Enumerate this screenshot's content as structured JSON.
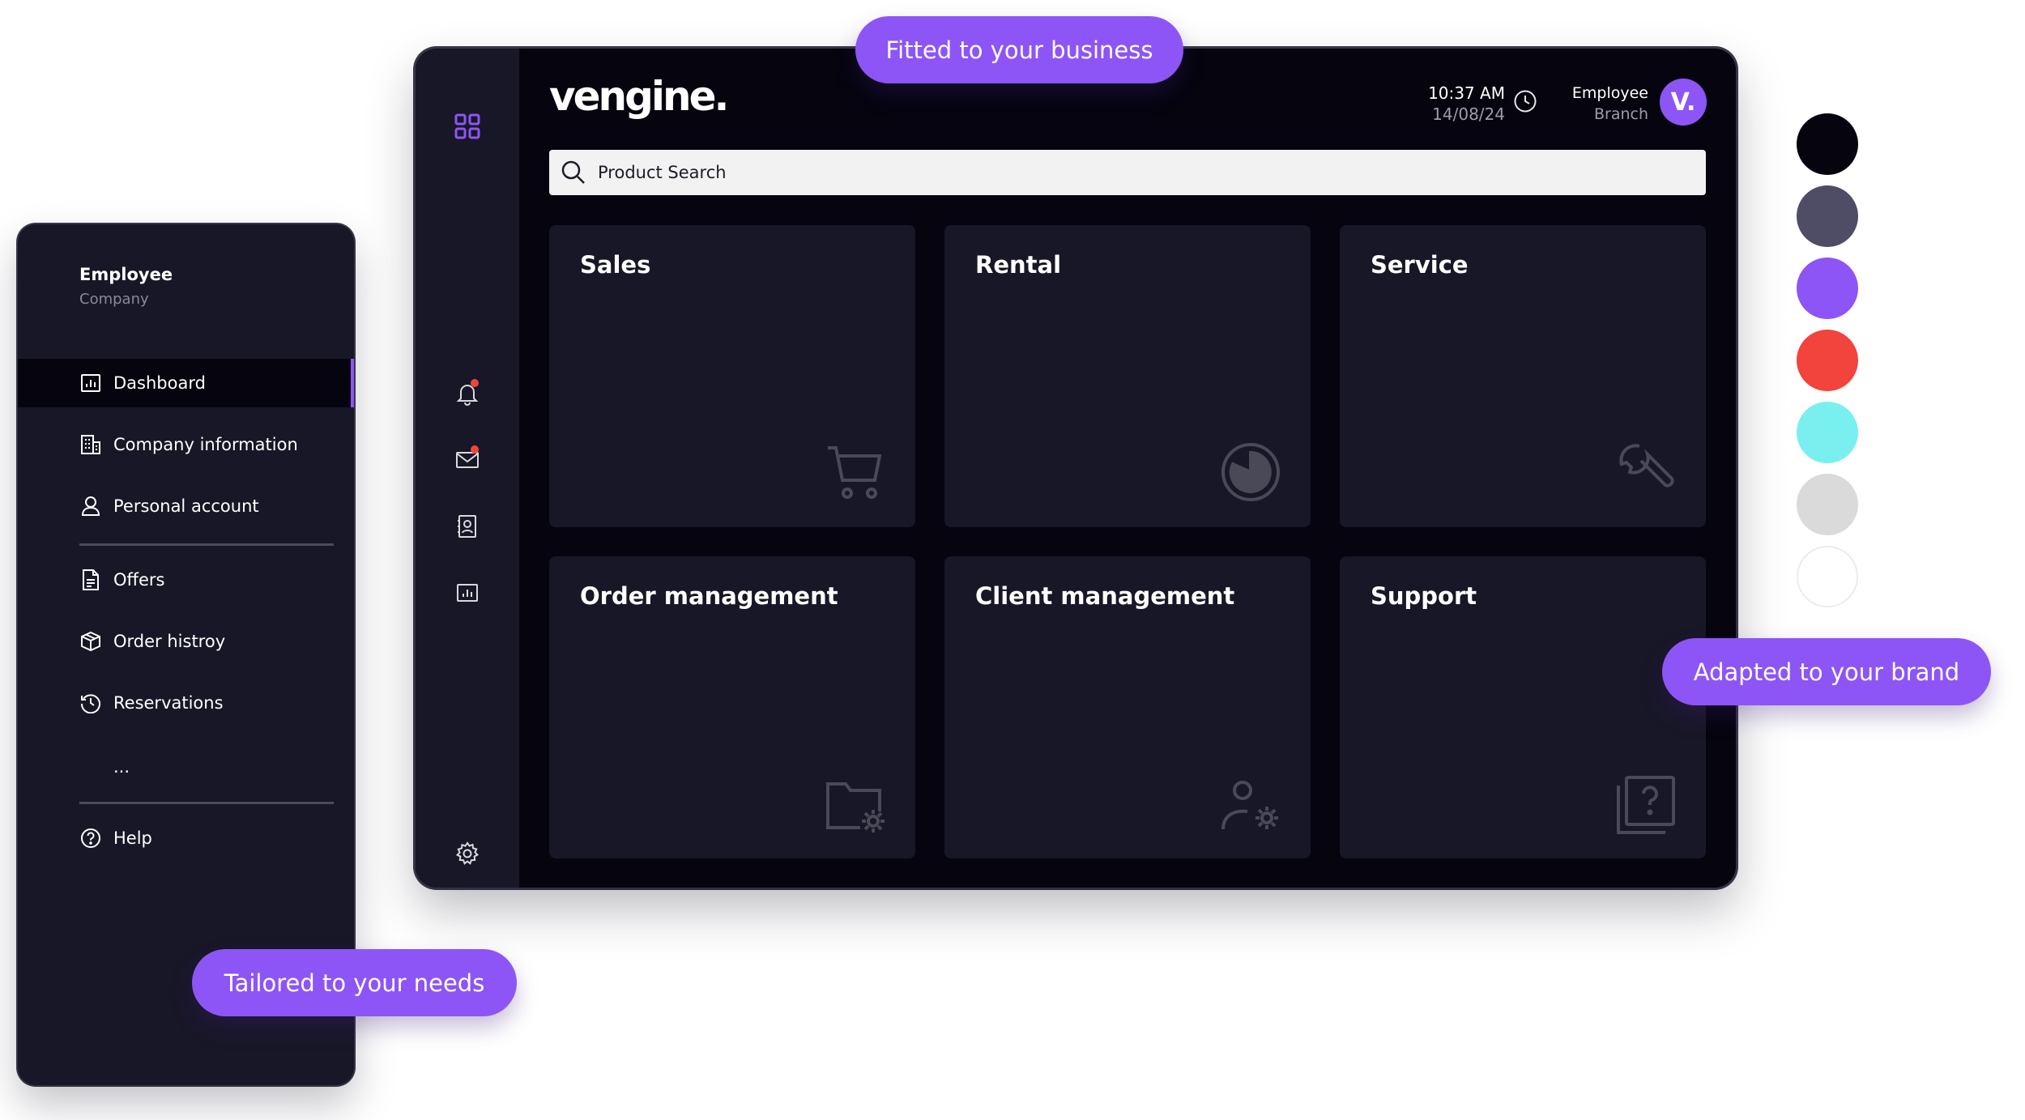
{
  "app": {
    "logo": "vengine.",
    "time": "10:37 AM",
    "date": "14/08/24",
    "user_name": "Employee",
    "user_branch": "Branch",
    "avatar_text": "V.",
    "search_placeholder": "Product Search",
    "tiles": [
      {
        "title": "Sales",
        "icon": "shopping-cart-icon"
      },
      {
        "title": "Rental",
        "icon": "pie-chart-icon"
      },
      {
        "title": "Service",
        "icon": "wrench-icon"
      },
      {
        "title": "Order management",
        "icon": "folder-settings-icon"
      },
      {
        "title": "Client management",
        "icon": "user-settings-icon"
      },
      {
        "title": "Support",
        "icon": "help-document-icon"
      }
    ],
    "rail_icons": [
      "apps-grid-icon",
      "bell-icon",
      "mail-icon",
      "contacts-icon",
      "chart-icon",
      "gear-icon"
    ]
  },
  "sidebar": {
    "user_name": "Employee",
    "company": "Company",
    "items": [
      {
        "label": "Dashboard",
        "icon": "chart-icon",
        "active": true
      },
      {
        "label": "Company information",
        "icon": "building-icon"
      },
      {
        "label": "Personal account",
        "icon": "user-icon"
      },
      {
        "label": "Offers",
        "icon": "document-icon"
      },
      {
        "label": "Order histroy",
        "icon": "box-icon"
      },
      {
        "label": "Reservations",
        "icon": "history-icon"
      },
      {
        "label": "Help",
        "icon": "help-circle-icon"
      }
    ],
    "more": "..."
  },
  "pills": {
    "business": "Fitted to your business",
    "brand": "Adapted to your brand",
    "needs": "Tailored to your needs"
  },
  "colors": {
    "accent": "#8d55f5",
    "notification": "#f2443c",
    "swatches": [
      "#05040f",
      "#4e4d65",
      "#8d55f5",
      "#f2443c",
      "#79f0ef",
      "#dadada",
      "#ffffff"
    ]
  }
}
